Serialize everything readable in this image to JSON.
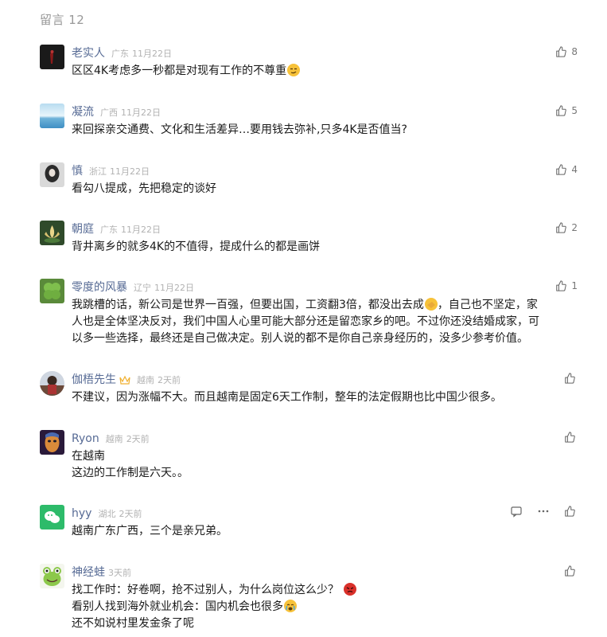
{
  "header": {
    "title": "留言 12"
  },
  "comments": [
    {
      "name": "老实人",
      "location": "广东",
      "time": "11月22日",
      "likes": "8",
      "text": [
        "区区4K考虑多一秒都是对现有工作的不尊重"
      ]
    },
    {
      "name": "凝流",
      "location": "广西",
      "time": "11月22日",
      "likes": "5",
      "text": [
        "来回探亲交通费、文化和生活差异…要用钱去弥补,只多4K是否值当?"
      ]
    },
    {
      "name": "慎",
      "location": "浙江",
      "time": "11月22日",
      "likes": "4",
      "text": [
        "看勾八提成，先把稳定的谈好"
      ]
    },
    {
      "name": "朝庭",
      "location": "广东",
      "time": "11月22日",
      "likes": "2",
      "text": [
        "背井离乡的就多4K的不值得，提成什么的都是画饼"
      ]
    },
    {
      "name": "零度的风暴",
      "location": "辽宁",
      "time": "11月22日",
      "likes": "1",
      "text": [
        "我跳槽的话，新公司是世界一百强，但要出国，工资翻3倍，都没出去成",
        "，自己也不坚定，家",
        "人也是全体坚决反对，我们中国人心里可能大部分还是留恋家乡的吧。不过你还没结婚成家，可",
        "以多一些选择，最终还是自己做决定。别人说的都不是你自己亲身经历的，没多少参考价值。"
      ]
    },
    {
      "name": "伽梧先生",
      "location": "越南",
      "time": "2天前",
      "likes": "",
      "text": [
        "不建议，因为涨幅不大。而且越南是固定6天工作制，整年的法定假期也比中国少很多。"
      ]
    },
    {
      "name": "Ryon",
      "location": "越南",
      "time": "2天前",
      "likes": "",
      "text": [
        "在越南",
        "这边的工作制是六天。。"
      ]
    },
    {
      "name": "hyy",
      "location": "湖北",
      "time": "2天前",
      "likes": "",
      "text": [
        "越南广东广西，三个是亲兄弟。"
      ]
    },
    {
      "name": "神经蛙",
      "location": "",
      "time": "3天前",
      "likes": "",
      "text": [
        "找工作时：好卷啊，抢不过别人，为什么岗位这么少？",
        "看别人找到海外就业机会：国内机会也很多",
        "还不如说村里发金条了呢"
      ]
    }
  ],
  "icons": {
    "like": "thumbs-up-icon",
    "reply": "comment-bubble-icon",
    "more": "more-dots-icon",
    "badge": "crown-badge-icon"
  },
  "colors": {
    "name": "#576b95",
    "meta": "#b2b2b2",
    "text": "#1a1a1a"
  }
}
